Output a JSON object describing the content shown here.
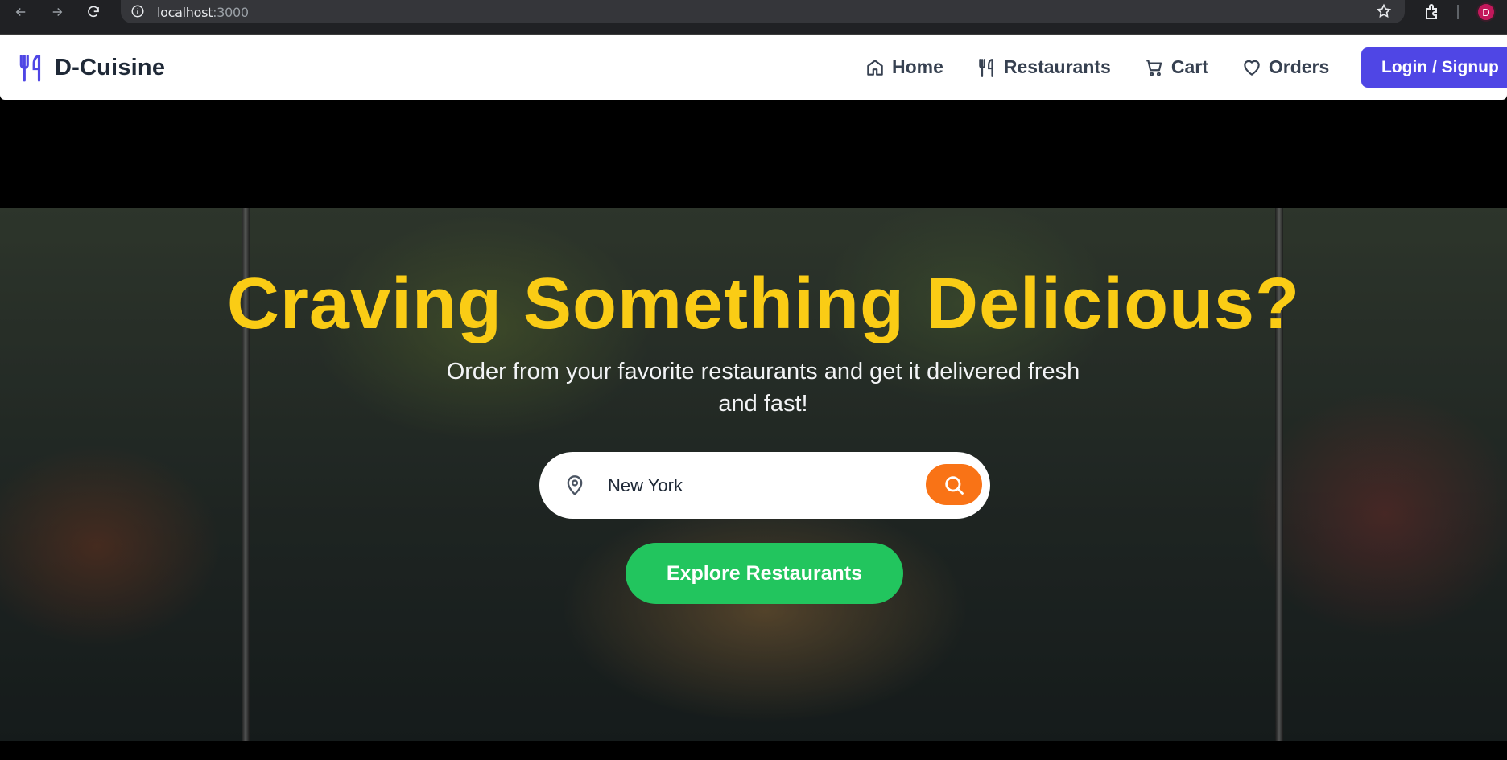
{
  "browser": {
    "url_host": "localhost",
    "url_port": ":3000",
    "profile_initial": "D"
  },
  "navbar": {
    "brand": "D-Cuisine",
    "links": [
      {
        "label": "Home",
        "icon": "home-icon"
      },
      {
        "label": "Restaurants",
        "icon": "utensils-icon"
      },
      {
        "label": "Cart",
        "icon": "cart-icon"
      },
      {
        "label": "Orders",
        "icon": "heart-icon"
      }
    ],
    "login_label": "Login / Signup"
  },
  "hero": {
    "title": "Craving Something Delicious?",
    "subtitle": "Order from your favorite restaurants and get it delivered fresh and fast!",
    "search": {
      "value": "New York",
      "icon": "map-pin-icon"
    },
    "explore_label": "Explore Restaurants"
  },
  "colors": {
    "brand": "#4f46e5",
    "title": "#facc15",
    "search_button": "#f97316",
    "explore_button": "#22c55e"
  }
}
